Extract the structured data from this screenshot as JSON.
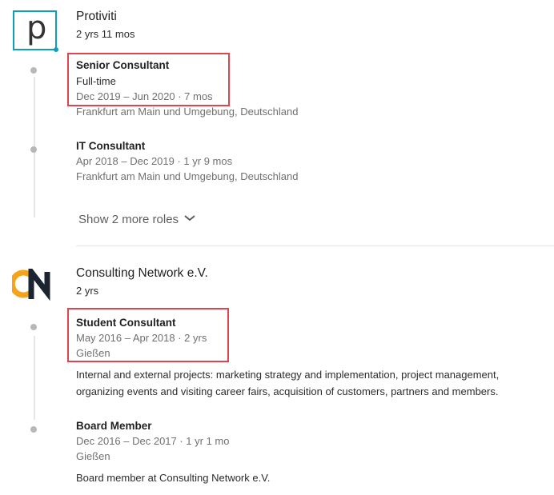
{
  "companies": [
    {
      "name": "Protiviti",
      "duration": "2 yrs 11 mos",
      "logo_glyph": "p",
      "logo_color": "#0d9fb8",
      "roles": [
        {
          "title": "Senior Consultant",
          "type": "Full-time",
          "dates": "Dec 2019 – Jun 2020 · 7 mos",
          "location": "Frankfurt am Main und Umgebung, Deutschland"
        },
        {
          "title": "IT Consultant",
          "dates": "Apr 2018 – Dec 2019 · 1 yr 9 mos",
          "location": "Frankfurt am Main und Umgebung, Deutschland"
        }
      ],
      "show_more_label": "Show 2 more roles"
    },
    {
      "name": "Consulting Network e.V.",
      "duration": "2 yrs",
      "logo_colors": {
        "orange": "#f5a31a",
        "dark": "#1c2430"
      },
      "roles": [
        {
          "title": "Student Consultant",
          "dates": "May 2016 – Apr 2018 · 2 yrs",
          "location": "Gießen",
          "description": "Internal and external projects: marketing strategy and implementation, project management, organizing events and visiting career fairs, acquisition of customers, partners and members."
        },
        {
          "title": "Board Member",
          "dates": "Dec 2016 – Dec 2017 · 1 yr 1 mo",
          "location": "Gießen",
          "description": "Board member at Consulting Network e.V."
        }
      ]
    }
  ],
  "highlight_color": "#e0444f"
}
